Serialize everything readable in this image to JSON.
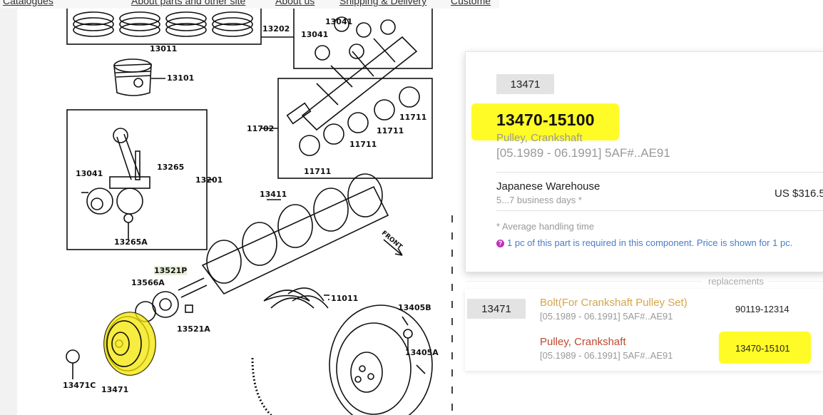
{
  "nav": {
    "items": [
      "Catalogues",
      "About parts and other site",
      "About us",
      "Shipping & Delivery",
      "Custome"
    ]
  },
  "diagram": {
    "labels": {
      "l13011": "13011",
      "l13101": "13101",
      "l13202": "13202",
      "l13041a": "13041",
      "l13041b": "13041",
      "l13041c": "13041",
      "l11702": "11702",
      "l11711a": "11711",
      "l11711b": "11711",
      "l11711c": "11711",
      "l11711d": "11711",
      "l13265": "13265",
      "l13201": "13201",
      "l13265A": "13265A",
      "l13411": "13411",
      "l13521P": "13521P",
      "l13566A": "13566A",
      "l13521A": "13521A",
      "l11011": "11011",
      "l13405B": "13405B",
      "l13405A": "13405A",
      "l13471C": "13471C",
      "l13471": "13471",
      "lFRONT": "FRONT"
    }
  },
  "card": {
    "ref": "13471",
    "part_number": "13470-15100",
    "part_name": "Pulley, Crankshaft",
    "dates": "[05.1989 - 06.1991] 5AF#..AE91",
    "warehouse": "Japanese Warehouse",
    "delivery": "5...7 business days *",
    "price": "US $316.5",
    "avg_note": "* Average handling time",
    "qty_note": "1 pc of this part is required in this component. Price is shown for 1 pc."
  },
  "replacements": {
    "title": "replacements",
    "ref": "13471",
    "items": [
      {
        "name": "Bolt(For Crankshaft Pulley Set)",
        "dates": "[05.1989 - 06.1991] 5AF#..AE91",
        "number": "90119-12314"
      },
      {
        "name": "Pulley, Crankshaft",
        "dates": "[05.1989 - 06.1991] 5AF#..AE91",
        "number": "13470-15101"
      }
    ]
  },
  "colors": {
    "highlight": "#fffa00",
    "bolt_link": "#d4a64a",
    "pulley_link": "#c0492f",
    "info_text": "#4a7cc4",
    "info_icon": "#c02ec0"
  },
  "icons": [
    "question-circle-icon"
  ]
}
